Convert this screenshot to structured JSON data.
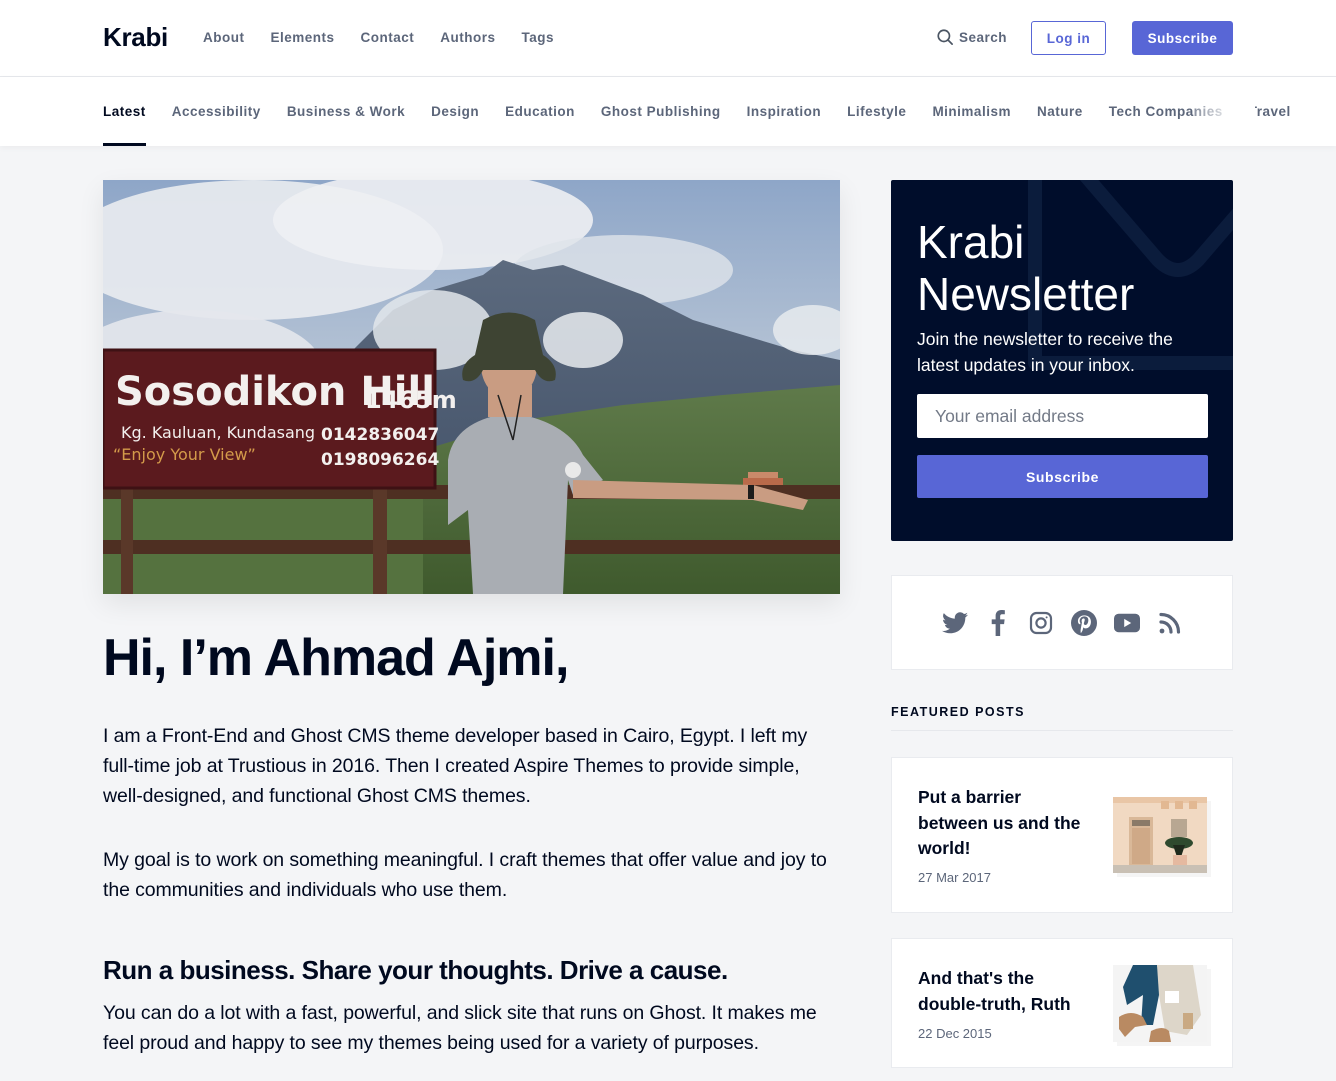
{
  "header": {
    "logo": "Krabi",
    "nav": [
      "About",
      "Elements",
      "Contact",
      "Authors",
      "Tags"
    ],
    "search_label": "Search",
    "login_label": "Log in",
    "subscribe_label": "Subscribe"
  },
  "tags": {
    "items": [
      "Latest",
      "Accessibility",
      "Business & Work",
      "Design",
      "Education",
      "Ghost Publishing",
      "Inspiration",
      "Lifestyle",
      "Minimalism",
      "Nature",
      "Tech Companies",
      "Travel"
    ],
    "active": "Latest"
  },
  "hero": {
    "alt": "Man in bucket hat standing by Sosodikon Hill sign with mountain in background",
    "sign_title": "Sosodikon Hill",
    "sign_elevation": "1465m",
    "sign_location": "Kg. Kauluan, Kundasang",
    "sign_slogan": "“Enjoy Your View”",
    "sign_phone1": "0142836047",
    "sign_phone2": "0198096264"
  },
  "article": {
    "title": "Hi, I’m Ahmad Ajmi,",
    "paragraphs": [
      "I am a Front-End and Ghost CMS theme developer based in Cairo, Egypt. I left my full-time job at Trustious in 2016. Then I created Aspire Themes to provide simple, well-designed, and functional Ghost CMS themes.",
      "My goal is to work on something meaningful. I craft themes that offer value and joy to the communities and individuals who use them."
    ],
    "subheading": "Run a business. Share your thoughts. Drive a cause.",
    "paragraph3": "You can do a lot with a fast, powerful, and slick site that runs on Ghost. It makes me feel proud and happy to see my themes being used for a variety of purposes."
  },
  "newsletter": {
    "title": "Krabi Newsletter",
    "description": "Join the newsletter to receive the latest updates in your inbox.",
    "email_placeholder": "Your email address",
    "button_label": "Subscribe"
  },
  "social": {
    "icons": [
      "twitter-icon",
      "facebook-icon",
      "instagram-icon",
      "pinterest-icon",
      "youtube-icon",
      "rss-icon"
    ],
    "color": "#5c667a"
  },
  "featured": {
    "heading": "FEATURED POSTS",
    "posts": [
      {
        "title": "Put a barrier between us and the world!",
        "date": "27 Mar 2017"
      },
      {
        "title": "And that's the double-truth, Ruth",
        "date": "22 Dec 2015"
      }
    ]
  },
  "colors": {
    "accent": "#5866d6",
    "dark": "#00091f",
    "muted": "#5c667a",
    "background": "#f4f5f7",
    "newsletter_bg": "#000d2b"
  }
}
